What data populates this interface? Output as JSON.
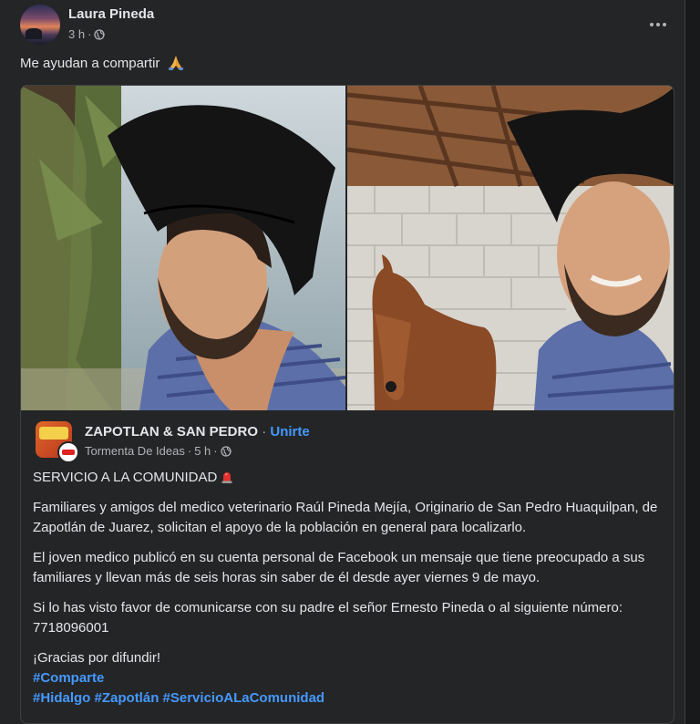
{
  "post": {
    "author": "Laura Pineda",
    "time": "3 h",
    "separator": "·",
    "text": "Me ayudan a compartir",
    "emoji_icon": "folded-hands-icon",
    "audience_icon": "globe-icon",
    "menu_icon": "more-options-icon"
  },
  "shared": {
    "page_name": "ZAPOTLAN & SAN PEDRO",
    "separator": "·",
    "join_label": "Unirte",
    "author": "Tormenta De Ideas",
    "time": "5 h",
    "heading": "SERVICIO A LA COMUNIDAD",
    "heading_icon": "siren-icon",
    "paragraph1": "Familiares y amigos del medico veterinario Raúl Pineda Mejía, Originario de San Pedro Huaquilpan, de Zapotlán de Juarez, solicitan el apoyo de la población en general para localizarlo.",
    "paragraph2": "El joven medico publicó en su cuenta personal de Facebook un mensaje que tiene preocupado a sus familiares y llevan más de seis horas sin saber de él desde ayer viernes 9 de mayo.",
    "paragraph3": "Si lo has visto favor de comunicarse con su padre el señor Ernesto Pineda o al siguiente número: 7718096001",
    "thanks": "¡Gracias por difundir!",
    "hashtag_share": "#Comparte",
    "hashtags": [
      "#Hidalgo",
      "#Zapotlán",
      "#ServicioALaComunidad"
    ]
  },
  "colors": {
    "background": "#242526",
    "text": "#e4e6eb",
    "secondary": "#b0b3b8",
    "link": "#4599ff"
  }
}
